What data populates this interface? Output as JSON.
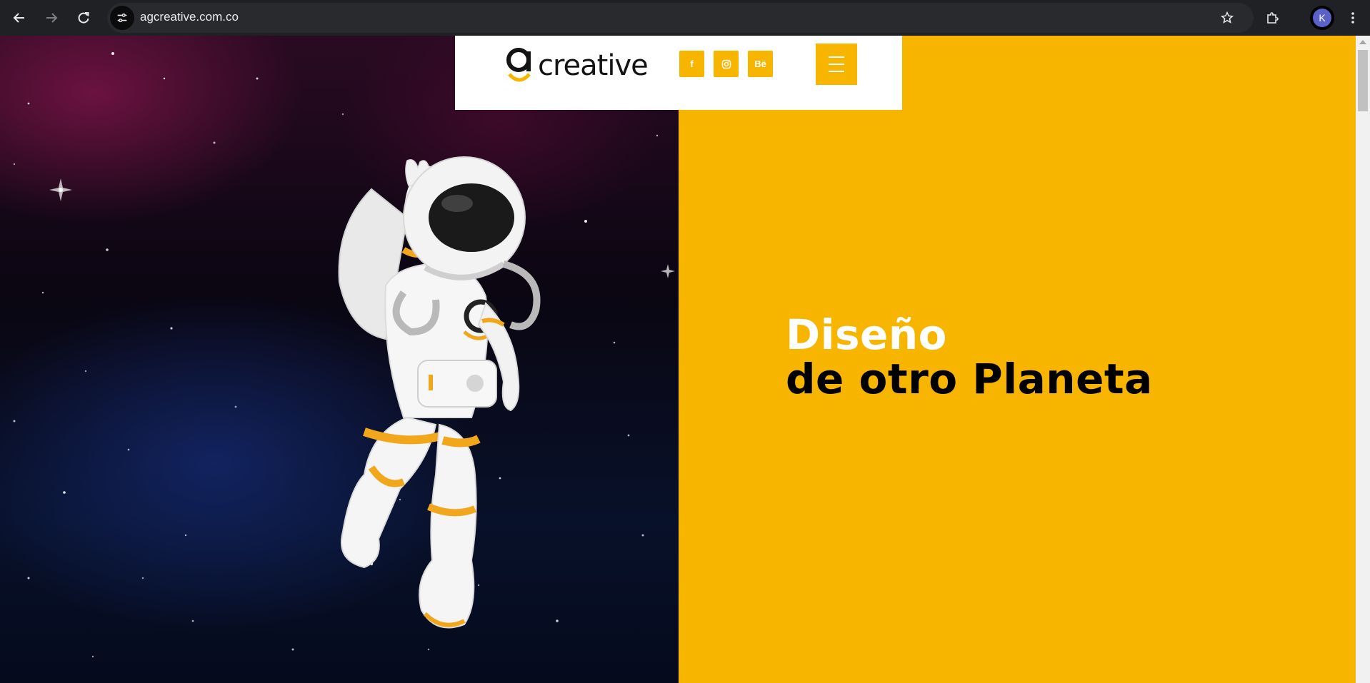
{
  "browser": {
    "url": "agcreative.com.co",
    "profile_initial": "K",
    "icons": {
      "back": "arrow-left-icon",
      "forward": "arrow-right-icon",
      "reload": "reload-icon",
      "site_info": "tune-icon",
      "bookmark": "star-icon",
      "extensions": "puzzle-icon",
      "menu": "kebab-icon"
    }
  },
  "header": {
    "logo_mark": "g",
    "logo_text": "creative",
    "social": [
      {
        "label": "f",
        "icon": "facebook-icon"
      },
      {
        "label": "",
        "icon": "instagram-icon"
      },
      {
        "label": "Bē",
        "icon": "behance-icon"
      }
    ],
    "menu_icon": "hamburger-icon"
  },
  "hero": {
    "line1": "Diseño",
    "line2": "de otro Planeta",
    "image": "astronaut-illustration"
  },
  "colors": {
    "brand_yellow": "#f7b500",
    "text_dark": "#000000",
    "text_light": "#ffffff",
    "chrome_bg": "#202124"
  }
}
